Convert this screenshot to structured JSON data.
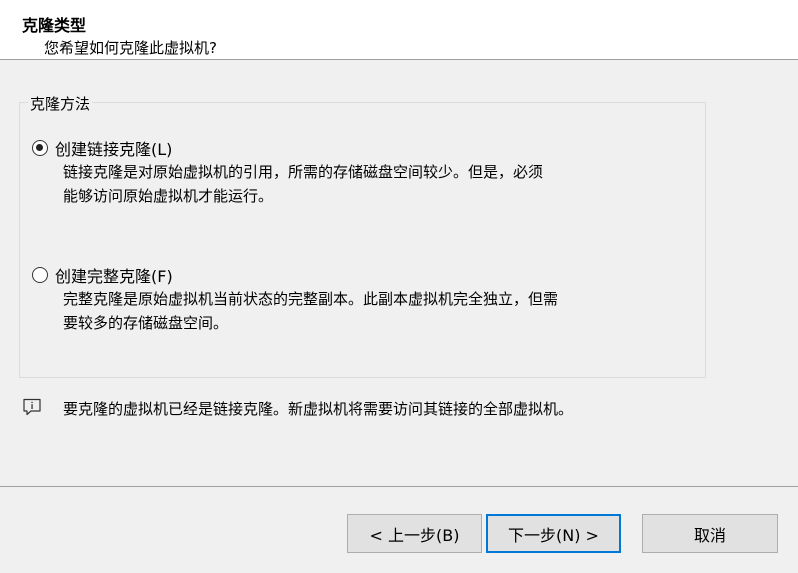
{
  "header": {
    "title": "克隆类型",
    "subtitle": "您希望如何克隆此虚拟机?"
  },
  "group": {
    "legend": "克隆方法",
    "options": [
      {
        "label": "创建链接克隆(L)",
        "checked": true,
        "description_lines": [
          "链接克隆是对原始虚拟机的引用，所需的存储磁盘空间较少。但是，必须",
          "能够访问原始虚拟机才能运行。"
        ]
      },
      {
        "label": "创建完整克隆(F)",
        "checked": false,
        "description_lines": [
          "完整克隆是原始虚拟机当前状态的完整副本。此副本虚拟机完全独立，但需",
          "要较多的存储磁盘空间。"
        ]
      }
    ]
  },
  "info": {
    "icon": "info-message-icon",
    "text": "要克隆的虚拟机已经是链接克隆。新虚拟机将需要访问其链接的全部虚拟机。"
  },
  "footer": {
    "back_label": "< 上一步(B)",
    "next_label": "下一步(N) >",
    "cancel_label": "取消"
  },
  "colors": {
    "accent": "#0078d7",
    "background": "#f0f0f0",
    "header_background": "#ffffff"
  }
}
